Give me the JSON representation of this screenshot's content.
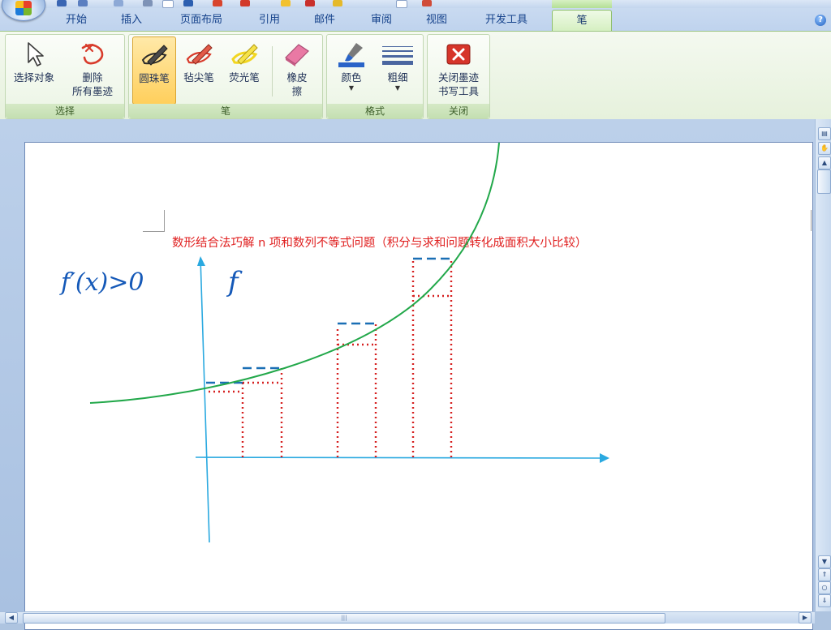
{
  "tabs": [
    {
      "label": "开始"
    },
    {
      "label": "插入"
    },
    {
      "label": "页面布局"
    },
    {
      "label": "引用"
    },
    {
      "label": "邮件"
    },
    {
      "label": "审阅"
    },
    {
      "label": "视图"
    },
    {
      "label": "开发工具"
    },
    {
      "label": "笔",
      "active": true
    }
  ],
  "ribbon": {
    "groups": {
      "select": {
        "label": "选择",
        "buttons": {
          "select_object": {
            "label": "选择对象"
          },
          "delete_all_ink": {
            "label_line1": "删除",
            "label_line2": "所有墨迹"
          }
        }
      },
      "pens": {
        "label": "笔",
        "buttons": {
          "ballpoint": {
            "label": "圆珠笔",
            "active": true
          },
          "felt_tip": {
            "label": "毡尖笔"
          },
          "highlighter": {
            "label": "荧光笔"
          },
          "eraser": {
            "label_line1": "橡皮",
            "label_line2": "擦"
          }
        }
      },
      "format": {
        "label": "格式",
        "buttons": {
          "color": {
            "label": "颜色"
          },
          "thickness": {
            "label": "粗细"
          }
        }
      },
      "close": {
        "label": "关闭",
        "buttons": {
          "close_ink_tools": {
            "label_line1": "关闭墨迹",
            "label_line2": "书写工具"
          }
        }
      }
    }
  },
  "document": {
    "title": "数形结合法巧解 n 项和数列不等式问题（积分与求和问题转化成面积大小比较）",
    "ink_text_1": "f′(x)>0",
    "ink_text_2": "f"
  },
  "colors": {
    "title_red": "#e02020",
    "curve_green": "#22a84a",
    "axis_cyan": "#2aa9e0",
    "dotted_red": "#d62020",
    "dashed_blue": "#1a6fb5",
    "ink_blue": "#1559b8"
  }
}
